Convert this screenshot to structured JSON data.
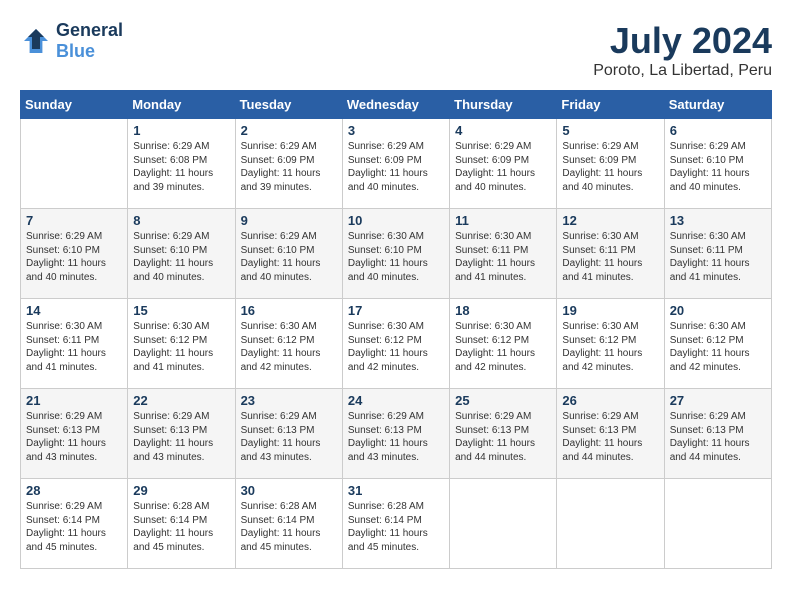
{
  "header": {
    "logo_line1": "General",
    "logo_line2": "Blue",
    "month_year": "July 2024",
    "location": "Poroto, La Libertad, Peru"
  },
  "days_of_week": [
    "Sunday",
    "Monday",
    "Tuesday",
    "Wednesday",
    "Thursday",
    "Friday",
    "Saturday"
  ],
  "weeks": [
    [
      {
        "day": "",
        "detail": ""
      },
      {
        "day": "1",
        "detail": "Sunrise: 6:29 AM\nSunset: 6:08 PM\nDaylight: 11 hours\nand 39 minutes."
      },
      {
        "day": "2",
        "detail": "Sunrise: 6:29 AM\nSunset: 6:09 PM\nDaylight: 11 hours\nand 39 minutes."
      },
      {
        "day": "3",
        "detail": "Sunrise: 6:29 AM\nSunset: 6:09 PM\nDaylight: 11 hours\nand 40 minutes."
      },
      {
        "day": "4",
        "detail": "Sunrise: 6:29 AM\nSunset: 6:09 PM\nDaylight: 11 hours\nand 40 minutes."
      },
      {
        "day": "5",
        "detail": "Sunrise: 6:29 AM\nSunset: 6:09 PM\nDaylight: 11 hours\nand 40 minutes."
      },
      {
        "day": "6",
        "detail": "Sunrise: 6:29 AM\nSunset: 6:10 PM\nDaylight: 11 hours\nand 40 minutes."
      }
    ],
    [
      {
        "day": "7",
        "detail": "Sunrise: 6:29 AM\nSunset: 6:10 PM\nDaylight: 11 hours\nand 40 minutes."
      },
      {
        "day": "8",
        "detail": "Sunrise: 6:29 AM\nSunset: 6:10 PM\nDaylight: 11 hours\nand 40 minutes."
      },
      {
        "day": "9",
        "detail": "Sunrise: 6:29 AM\nSunset: 6:10 PM\nDaylight: 11 hours\nand 40 minutes."
      },
      {
        "day": "10",
        "detail": "Sunrise: 6:30 AM\nSunset: 6:10 PM\nDaylight: 11 hours\nand 40 minutes."
      },
      {
        "day": "11",
        "detail": "Sunrise: 6:30 AM\nSunset: 6:11 PM\nDaylight: 11 hours\nand 41 minutes."
      },
      {
        "day": "12",
        "detail": "Sunrise: 6:30 AM\nSunset: 6:11 PM\nDaylight: 11 hours\nand 41 minutes."
      },
      {
        "day": "13",
        "detail": "Sunrise: 6:30 AM\nSunset: 6:11 PM\nDaylight: 11 hours\nand 41 minutes."
      }
    ],
    [
      {
        "day": "14",
        "detail": "Sunrise: 6:30 AM\nSunset: 6:11 PM\nDaylight: 11 hours\nand 41 minutes."
      },
      {
        "day": "15",
        "detail": "Sunrise: 6:30 AM\nSunset: 6:12 PM\nDaylight: 11 hours\nand 41 minutes."
      },
      {
        "day": "16",
        "detail": "Sunrise: 6:30 AM\nSunset: 6:12 PM\nDaylight: 11 hours\nand 42 minutes."
      },
      {
        "day": "17",
        "detail": "Sunrise: 6:30 AM\nSunset: 6:12 PM\nDaylight: 11 hours\nand 42 minutes."
      },
      {
        "day": "18",
        "detail": "Sunrise: 6:30 AM\nSunset: 6:12 PM\nDaylight: 11 hours\nand 42 minutes."
      },
      {
        "day": "19",
        "detail": "Sunrise: 6:30 AM\nSunset: 6:12 PM\nDaylight: 11 hours\nand 42 minutes."
      },
      {
        "day": "20",
        "detail": "Sunrise: 6:30 AM\nSunset: 6:12 PM\nDaylight: 11 hours\nand 42 minutes."
      }
    ],
    [
      {
        "day": "21",
        "detail": "Sunrise: 6:29 AM\nSunset: 6:13 PM\nDaylight: 11 hours\nand 43 minutes."
      },
      {
        "day": "22",
        "detail": "Sunrise: 6:29 AM\nSunset: 6:13 PM\nDaylight: 11 hours\nand 43 minutes."
      },
      {
        "day": "23",
        "detail": "Sunrise: 6:29 AM\nSunset: 6:13 PM\nDaylight: 11 hours\nand 43 minutes."
      },
      {
        "day": "24",
        "detail": "Sunrise: 6:29 AM\nSunset: 6:13 PM\nDaylight: 11 hours\nand 43 minutes."
      },
      {
        "day": "25",
        "detail": "Sunrise: 6:29 AM\nSunset: 6:13 PM\nDaylight: 11 hours\nand 44 minutes."
      },
      {
        "day": "26",
        "detail": "Sunrise: 6:29 AM\nSunset: 6:13 PM\nDaylight: 11 hours\nand 44 minutes."
      },
      {
        "day": "27",
        "detail": "Sunrise: 6:29 AM\nSunset: 6:13 PM\nDaylight: 11 hours\nand 44 minutes."
      }
    ],
    [
      {
        "day": "28",
        "detail": "Sunrise: 6:29 AM\nSunset: 6:14 PM\nDaylight: 11 hours\nand 45 minutes."
      },
      {
        "day": "29",
        "detail": "Sunrise: 6:28 AM\nSunset: 6:14 PM\nDaylight: 11 hours\nand 45 minutes."
      },
      {
        "day": "30",
        "detail": "Sunrise: 6:28 AM\nSunset: 6:14 PM\nDaylight: 11 hours\nand 45 minutes."
      },
      {
        "day": "31",
        "detail": "Sunrise: 6:28 AM\nSunset: 6:14 PM\nDaylight: 11 hours\nand 45 minutes."
      },
      {
        "day": "",
        "detail": ""
      },
      {
        "day": "",
        "detail": ""
      },
      {
        "day": "",
        "detail": ""
      }
    ]
  ]
}
